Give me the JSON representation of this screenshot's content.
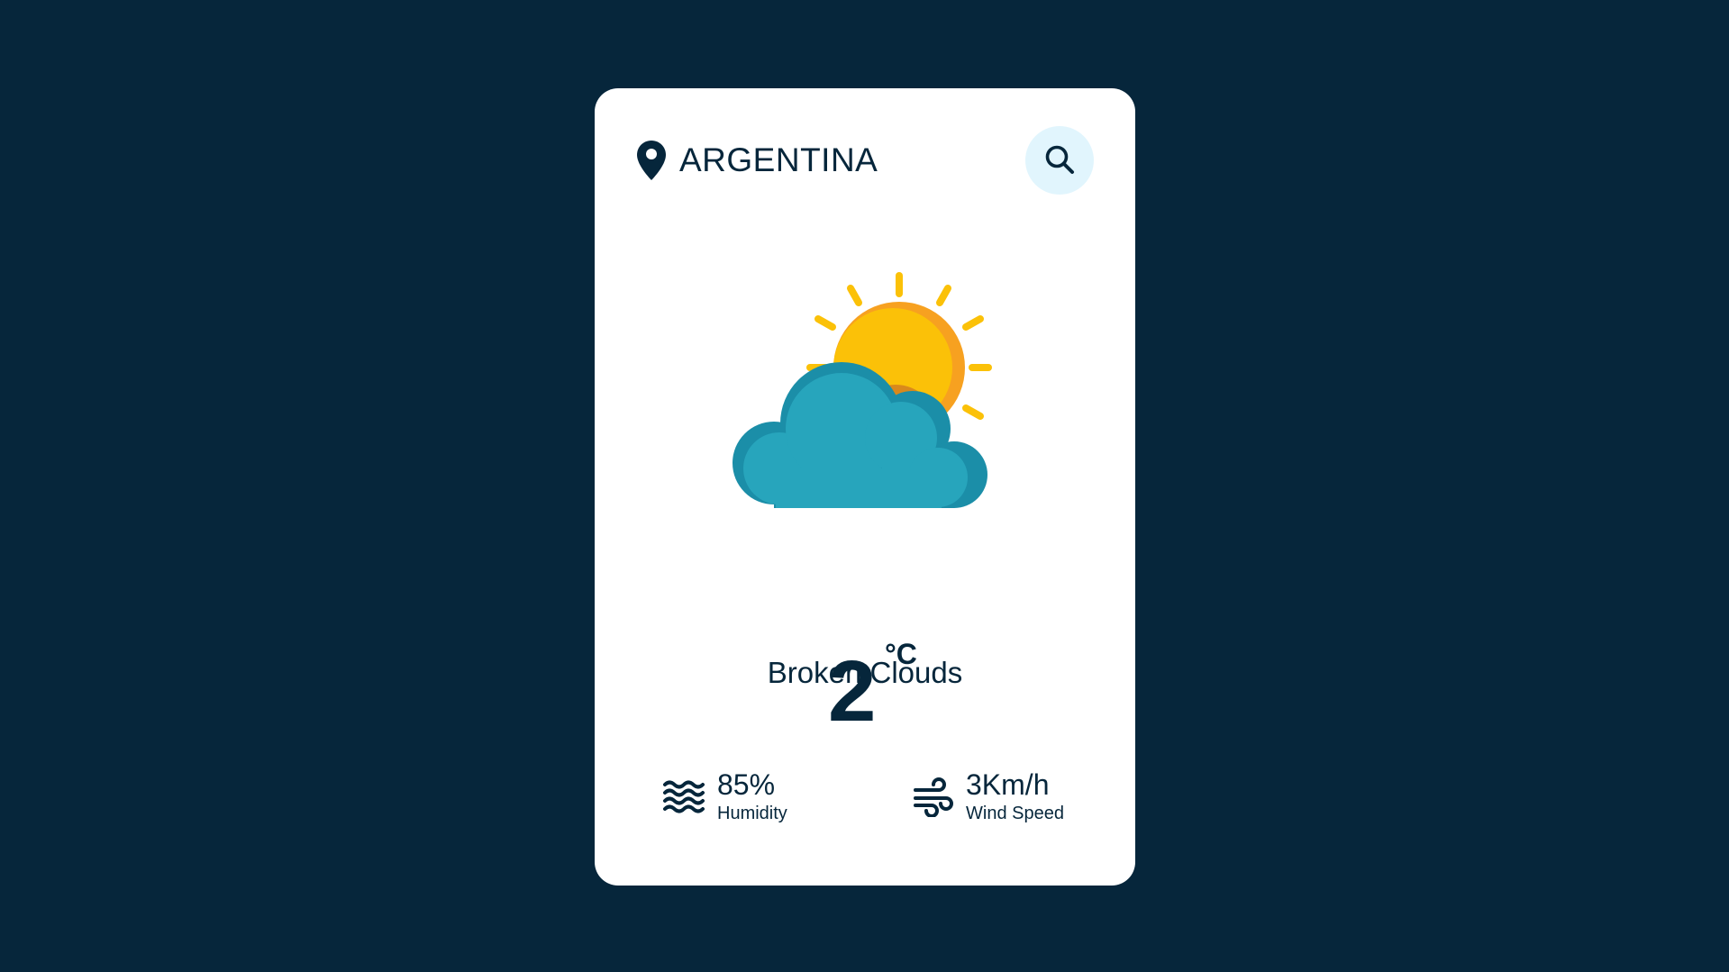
{
  "location": {
    "name": "ARGENTINA",
    "icon": "map-pin-icon"
  },
  "search": {
    "icon": "search-icon"
  },
  "weather": {
    "icon": "partly-cloudy-icon",
    "temperature": "2",
    "unit": "°C",
    "condition": "Broken Clouds"
  },
  "stats": {
    "humidity": {
      "value": "85%",
      "label": "Humidity",
      "icon": "waves-icon"
    },
    "wind": {
      "value": "3Km/h",
      "label": "Wind Speed",
      "icon": "wind-icon"
    }
  },
  "colors": {
    "background": "#06263b",
    "card": "#ffffff",
    "text": "#06263b",
    "search_bg": "#e1f5fd",
    "sun": "#fbc108",
    "sun_shade": "#f7a120",
    "cloud": "#27a5bc",
    "cloud_shade": "#1b8ea8"
  }
}
